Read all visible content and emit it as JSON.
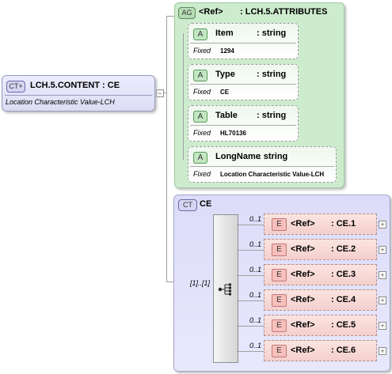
{
  "root": {
    "badge": "CT",
    "title": "LCH.5.CONTENT : CE",
    "documentation": "Location Characteristic Value-LCH"
  },
  "attribute_group": {
    "badge": "AG",
    "ref": "<Ref>",
    "name": ": LCH.5.ATTRIBUTES",
    "attributes": [
      {
        "badge": "A",
        "name": "Item",
        "type": ": string",
        "fixed_label": "Fixed",
        "fixed_value": "1294"
      },
      {
        "badge": "A",
        "name": "Type",
        "type": ": string",
        "fixed_label": "Fixed",
        "fixed_value": "CE"
      },
      {
        "badge": "A",
        "name": "Table",
        "type": ": string",
        "fixed_label": "Fixed",
        "fixed_value": "HL70136"
      },
      {
        "badge": "A",
        "name": "LongName",
        "type": ": string",
        "fixed_label": "Fixed",
        "fixed_value": "Location Characteristic Value-LCH"
      }
    ]
  },
  "complex_type": {
    "badge": "CT",
    "name": "CE",
    "multiplicity": "[1]..[1]"
  },
  "elements": [
    {
      "badge": "E",
      "ref": "<Ref>",
      "name": ": CE.1",
      "occurs": "0..1"
    },
    {
      "badge": "E",
      "ref": "<Ref>",
      "name": ": CE.2",
      "occurs": "0..1"
    },
    {
      "badge": "E",
      "ref": "<Ref>",
      "name": ": CE.3",
      "occurs": "0..1"
    },
    {
      "badge": "E",
      "ref": "<Ref>",
      "name": ": CE.4",
      "occurs": "0..1"
    },
    {
      "badge": "E",
      "ref": "<Ref>",
      "name": ": CE.5",
      "occurs": "0..1"
    },
    {
      "badge": "E",
      "ref": "<Ref>",
      "name": ": CE.6",
      "occurs": "0..1"
    }
  ]
}
